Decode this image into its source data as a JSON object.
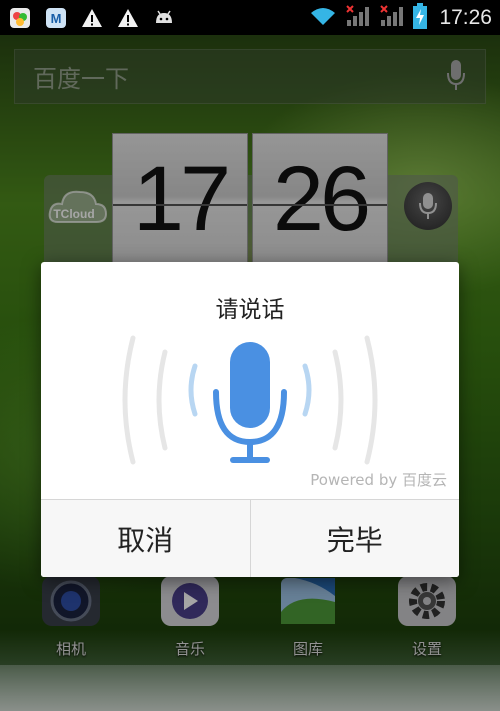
{
  "status_bar": {
    "time": "17:26",
    "icons": [
      "app-notification-icon",
      "maxthon-icon",
      "warning-icon",
      "warning-icon",
      "android-debug-icon",
      "wifi-icon",
      "signal-no-service-icon",
      "signal-no-service-icon",
      "battery-charging-icon"
    ]
  },
  "search": {
    "placeholder": "百度一下"
  },
  "clock": {
    "hours": "17",
    "minutes": "26",
    "brand": "TCloud"
  },
  "dock": {
    "items": [
      {
        "label": "相机",
        "icon": "camera-icon"
      },
      {
        "label": "音乐",
        "icon": "music-icon"
      },
      {
        "label": "图库",
        "icon": "gallery-icon"
      },
      {
        "label": "设置",
        "icon": "settings-icon"
      }
    ]
  },
  "dialog": {
    "title": "请说话",
    "powered_by": "Powered by 百度云",
    "cancel_label": "取消",
    "done_label": "完毕"
  },
  "colors": {
    "mic_blue": "#4a90e2",
    "wave_light_blue": "#b8d6f2",
    "wave_gray": "#e4e4e4"
  }
}
